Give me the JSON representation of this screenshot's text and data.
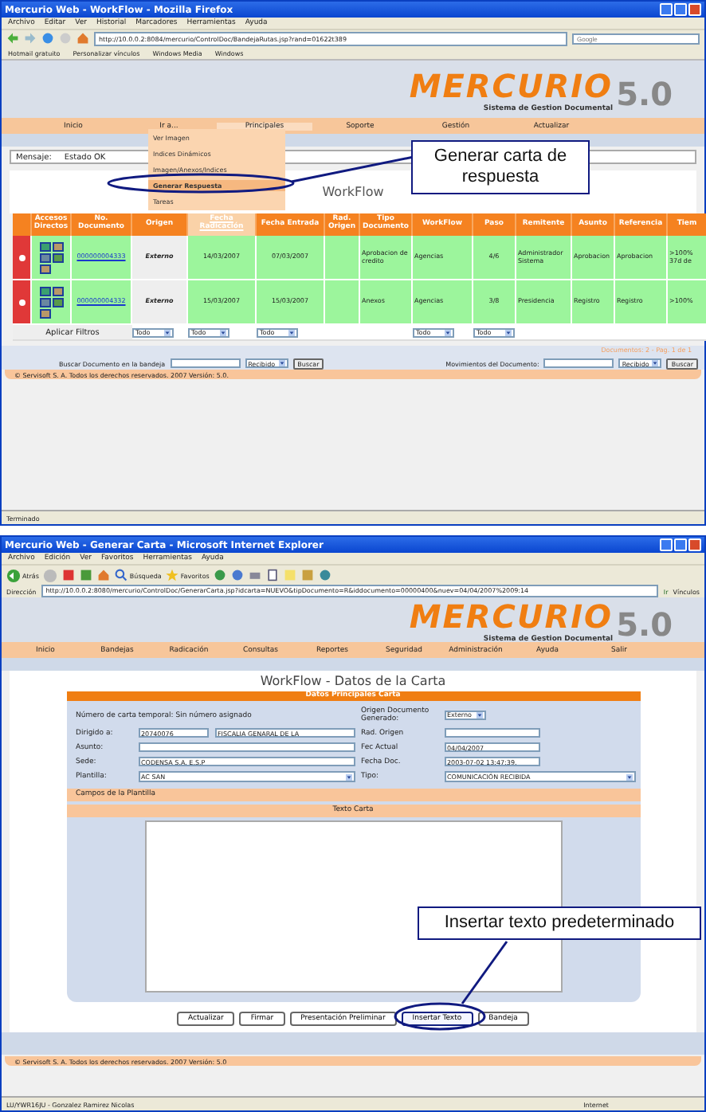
{
  "firefox_window": {
    "title": "Mercurio Web - WorkFlow - Mozilla Firefox",
    "menu": [
      "Archivo",
      "Editar",
      "Ver",
      "Historial",
      "Marcadores",
      "Herramientas",
      "Ayuda"
    ],
    "address": "http://10.0.0.2:8084/mercurio/ControlDoc/BandejaRutas.jsp?rand=01622t389",
    "search_placeholder": "Google",
    "bookmarks": [
      "Hotmail gratuito",
      "Personalizar vínculos",
      "Windows Media",
      "Windows"
    ],
    "logo": {
      "name": "MERCURIO",
      "subtitle": "Sistema de Gestion Documental",
      "version": "5.0"
    },
    "nav": [
      {
        "label": "Inicio",
        "selected": false
      },
      {
        "label": "Ir a...",
        "selected": false
      },
      {
        "label": "Principales",
        "selected": true
      },
      {
        "label": "Soporte",
        "selected": false
      },
      {
        "label": "Gestión",
        "selected": false
      },
      {
        "label": "Actualizar",
        "selected": false
      }
    ],
    "dropdown": [
      {
        "label": "Ver Imagen",
        "selected": false
      },
      {
        "label": "Indices Dinámicos",
        "selected": false
      },
      {
        "label": "Imagen/Anexos/Indices",
        "selected": false
      },
      {
        "label": "Generar Respuesta",
        "selected": true
      },
      {
        "label": "Tareas",
        "selected": false
      }
    ],
    "message": {
      "label": "Mensaje:",
      "value": "Estado OK"
    },
    "heading": "WorkFlow",
    "table": {
      "columns": [
        {
          "label": "Accesos Directos",
          "selected": false
        },
        {
          "label": "No. Documento",
          "selected": false
        },
        {
          "label": "Origen",
          "selected": false
        },
        {
          "label": "Fecha Radicación",
          "selected": true
        },
        {
          "label": "Fecha Entrada",
          "selected": false
        },
        {
          "label": "Rad. Origen",
          "selected": false
        },
        {
          "label": "Tipo Documento",
          "selected": false
        },
        {
          "label": "WorkFlow",
          "selected": false
        },
        {
          "label": "Paso",
          "selected": false
        },
        {
          "label": "Remitente",
          "selected": false
        },
        {
          "label": "Asunto",
          "selected": false
        },
        {
          "label": "Referencia",
          "selected": false
        },
        {
          "label": "Tiem",
          "selected": false
        }
      ],
      "rows": [
        {
          "selected": false,
          "document": "000000004333",
          "origin": "Externo",
          "filed": "14/03/2007",
          "entered": "07/03/2007",
          "type": "Aprobacion de credito",
          "workflow": "Agencias",
          "step": "4/6",
          "sender": "Administrador Sistema",
          "subject": "Aprobacion",
          "reference": "Aprobacion",
          "time": ">100% 37d de"
        },
        {
          "selected": false,
          "document": "000000004332",
          "origin": "Externo",
          "filed": "15/03/2007",
          "entered": "15/03/2007",
          "type": "Anexos",
          "workflow": "Agencias",
          "step": "3/8",
          "sender": "Presidencia",
          "subject": "Registro",
          "reference": "Registro",
          "time": ">100%"
        }
      ],
      "apply_filters": "Aplicar Filtros",
      "filters": [
        {
          "kind": "select",
          "value": "Todo"
        },
        {
          "kind": "select",
          "value": "Todo"
        },
        {
          "kind": "select",
          "value": "Todo"
        },
        {
          "kind": "blank"
        },
        {
          "kind": "blank"
        },
        {
          "kind": "select",
          "value": "Todo"
        },
        {
          "kind": "select",
          "value": "Todo"
        }
      ]
    },
    "pager": "Documentos: 2 - Pag. 1 de 1",
    "search": {
      "label": "Buscar Documento en la bandeja",
      "select": "Recibido",
      "button": "Buscar"
    },
    "movements": {
      "label": "Movimientos del Documento:",
      "select": "Recibido",
      "button": "Buscar"
    },
    "footer": "© Servisoft S. A. Todos los derechos reservados. 2007 Versión: 5.0.",
    "status": "Terminado",
    "callout": "Generar carta de respuesta"
  },
  "ie_window": {
    "title": "Mercurio Web - Generar Carta - Microsoft Internet Explorer",
    "menu": [
      "Archivo",
      "Edición",
      "Ver",
      "Favoritos",
      "Herramientas",
      "Ayuda"
    ],
    "toolbar": {
      "back": "Atrás",
      "search": "Búsqueda",
      "favorites": "Favoritos"
    },
    "address_label": "Dirección",
    "address": "http://10.0.0.2:8080/mercurio/ControlDoc/GenerarCarta.jsp?idcarta=NUEVO&tipDocumento=R&iddocumento=00000400&nuev=04/04/2007%2009:14",
    "go": "Ir",
    "links": "Vínculos",
    "logo": {
      "name": "MERCURIO",
      "subtitle": "Sistema de Gestion Documental",
      "version": "5.0"
    },
    "nav": [
      "Inicio",
      "Bandejas",
      "Radicación",
      "Consultas",
      "Reportes",
      "Seguridad",
      "Administración",
      "Ayuda",
      "Salir"
    ],
    "heading": "WorkFlow - Datos de la Carta",
    "section": "Datos Principales Carta",
    "letter_number": "Número de carta temporal: Sin número asignado",
    "origin": {
      "label": "Origen Documento Generado:",
      "value": "Externo"
    },
    "addressee": {
      "label": "Dirigido a:",
      "code": "20740076",
      "name": "FISCALIA GENARAL DE LA"
    },
    "rad_origin": {
      "label": "Rad. Origen"
    },
    "subject": {
      "label": "Asunto:"
    },
    "current_date": {
      "label": "Fec Actual",
      "value": "04/04/2007"
    },
    "site": {
      "label": "Sede:",
      "value": "CODENSA S.A. E.S.P"
    },
    "doc_date": {
      "label": "Fecha Doc.",
      "value": "2003-07-02 13:47:39."
    },
    "template": {
      "label": "Plantilla:",
      "value": "AC SAN"
    },
    "type": {
      "label": "Tipo:",
      "value": "COMUNICACIÓN RECIBIDA"
    },
    "template_fields": "Campos de la Plantilla",
    "letter_text": "Texto Carta",
    "buttons": [
      {
        "label": "Actualizar",
        "selected": false
      },
      {
        "label": "Firmar",
        "selected": false
      },
      {
        "label": "Presentación Preliminar",
        "selected": false
      },
      {
        "label": "Insertar Texto",
        "selected": true
      },
      {
        "label": "Bandeja",
        "selected": false
      }
    ],
    "footer": "© Servisoft S. A. Todos los derechos reservados. 2007 Versión: 5.0",
    "status": "LU/YWR16JU - Gonzalez Ramirez Nicolas",
    "zone": "Internet",
    "callout": "Insertar texto predeterminado"
  }
}
